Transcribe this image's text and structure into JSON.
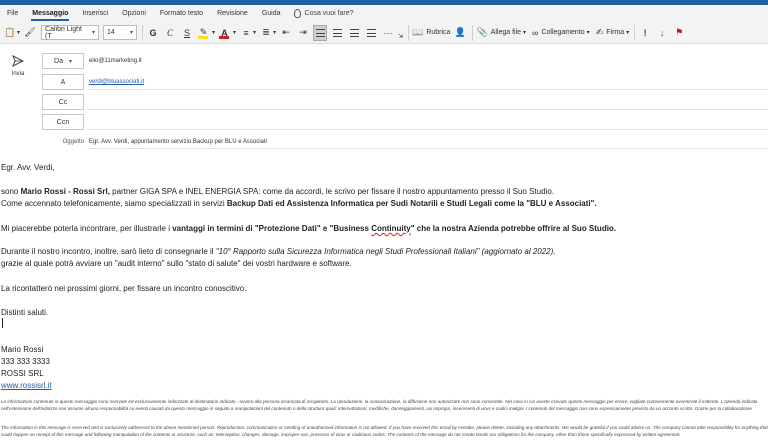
{
  "menu": {
    "tabs": [
      "File",
      "Messaggio",
      "Inserisci",
      "Opzioni",
      "Formato testo",
      "Revisione",
      "Guida"
    ],
    "active": "Messaggio",
    "tellme": "Cosa vuoi fare?"
  },
  "ribbon": {
    "font_name": "Calibri Light (T",
    "font_size": "14",
    "bold": "G",
    "italic": "C",
    "underline": "S",
    "more": "···",
    "rubrica": "Rubrica",
    "allega_file": "Allega file",
    "collegamento": "Collegamento",
    "firma": "Firma"
  },
  "header": {
    "send_label": "Invia",
    "from_label": "Da",
    "from_value": "elio@11marketing.it",
    "to_label": "A",
    "to_value": "verdi@bluassociati.it",
    "cc_label": "Cc",
    "ccn_label": "Ccn",
    "subject_label": "Oggetto",
    "subject_value": "Egr. Avv. Verdi, appuntamento servizio Backup per BLU e Associati"
  },
  "body": {
    "greeting": "Egr. Avv. Verdi,",
    "p1a_1": "sono ",
    "p1a_2": "Mario Rossi - Rossi Srl,",
    "p1a_3": " partner GIGA SPA e INEL ENERGIA SPA: come da accordi, le scrivo per fissare il nostro appuntamento presso il Suo Studio.",
    "p1b_1": "Come accennato telefonicamente, siamo specializzati in servizi ",
    "p1b_2": "Backup Dati ed Assistenza Informatica per Sudi Notarili e Studi Legali come la \"BLU e Associati\".",
    "p2_1": "Mi piacerebbe poterla incontrare, per illustrarle i ",
    "p2_2": "vantaggi in termini di \"Protezione Dati\" e \"Business ",
    "p2_3": "Continuity",
    "p2_4": "\" che la nostra Azienda potrebbe offrire al Suo Studio.",
    "p3a_1": "Durante il nostro incontro, inoltre, sarò lieto di consegnarle il ",
    "p3a_2": "\"10° Rapporto sulla Sicurezza Informatica negli Studi Professionali Italiani\" (aggiornato al 2022),",
    "p3b": "grazie al quale potrà avviare un \"audit interno\" sullo \"stato di salute\" dei vostri hardware e software.",
    "p4": "La ricontatterò nei prossimi giorni, per fissare un incontro conoscitivo.",
    "closing": "Distinti saluti.",
    "sig_name": "Mario Rossi",
    "sig_phone": "333 333 3333",
    "sig_company": "ROSSI SRL",
    "sig_site": "www.rossisrl.it",
    "disclaimer_it": "Le informazioni contenute in questo messaggio sono riservate ed esclusivamente indirizzate al destinatario indicato - ovvero alla persona incaricata di recapitarlo. La riproduzione, la comunicazione, la diffusione non autorizzate non sono consentite. Nel caso in cui aveste ricevuto questo messaggio per errore, vogliate cortesemente avvertirete il mittente. L'azienda indicata nell'estensione dell'indirizzo non assume alcuna responsabilità su eventi causati da questo messaggio in seguito a manipolazioni del contenuto o della struttura quali: intercettazioni, modifiche, danneggiamenti, usi impropri, inserimenti di virus e codici maligni. I contenuti del messaggio non sono espressamente previsto da un accordo scritto. Grazie per la collaborazione",
    "disclaimer_en": "The information in this message is reserved and is exclusively addressed to the above mentioned person. Reproduction, communication or sending of unauthorised information is not allowed. If you have received this email by mistake, please delete, including any attachments. We would be grateful if you could advise us. The company cannot take responsibility for anything that could happen on receipt of this message and following manipulation of the contents or structure, such as: interception, changes, damage, improper use, presence of virus or malicious codes. The contents of the message do not create bonds nor obligations for the company, other than those specifically expressed by written agreement."
  }
}
